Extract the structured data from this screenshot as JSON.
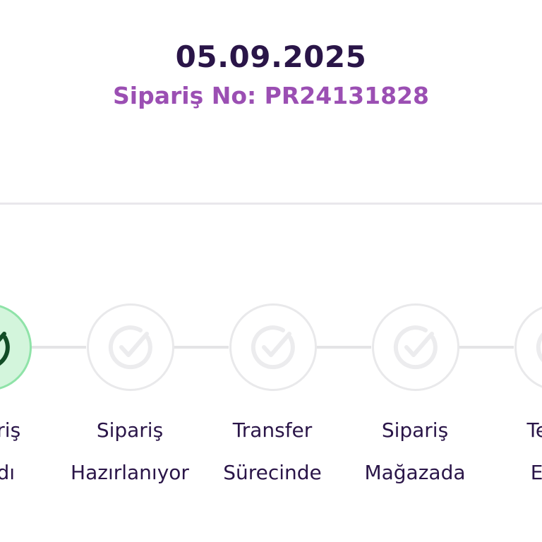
{
  "header": {
    "date": "05.09.2025",
    "order_number": "Sipariş No: PR24131828"
  },
  "tracker": {
    "steps": [
      {
        "line1": "Sipariş",
        "line2": "Alındı",
        "status": "completed",
        "icon": "check-circle-icon"
      },
      {
        "line1": "Sipariş",
        "line2": "Hazırlanıyor",
        "status": "pending",
        "icon": "check-circle-icon"
      },
      {
        "line1": "Transfer",
        "line2": "Sürecinde",
        "status": "pending",
        "icon": "check-circle-icon"
      },
      {
        "line1": "Sipariş",
        "line2": "Mağazada",
        "status": "pending",
        "icon": "check-circle-icon"
      },
      {
        "line1": "Teslim",
        "line2": "Edildi",
        "status": "pending",
        "icon": "check-circle-icon"
      }
    ]
  },
  "colors": {
    "date_text": "#2a1548",
    "order_text": "#9b4fb3",
    "completed_fill": "#d3f5dc",
    "completed_border": "#8fe3a8",
    "completed_icon": "#124d26",
    "pending_border": "#e9e9eb",
    "pending_icon": "#ececee"
  }
}
